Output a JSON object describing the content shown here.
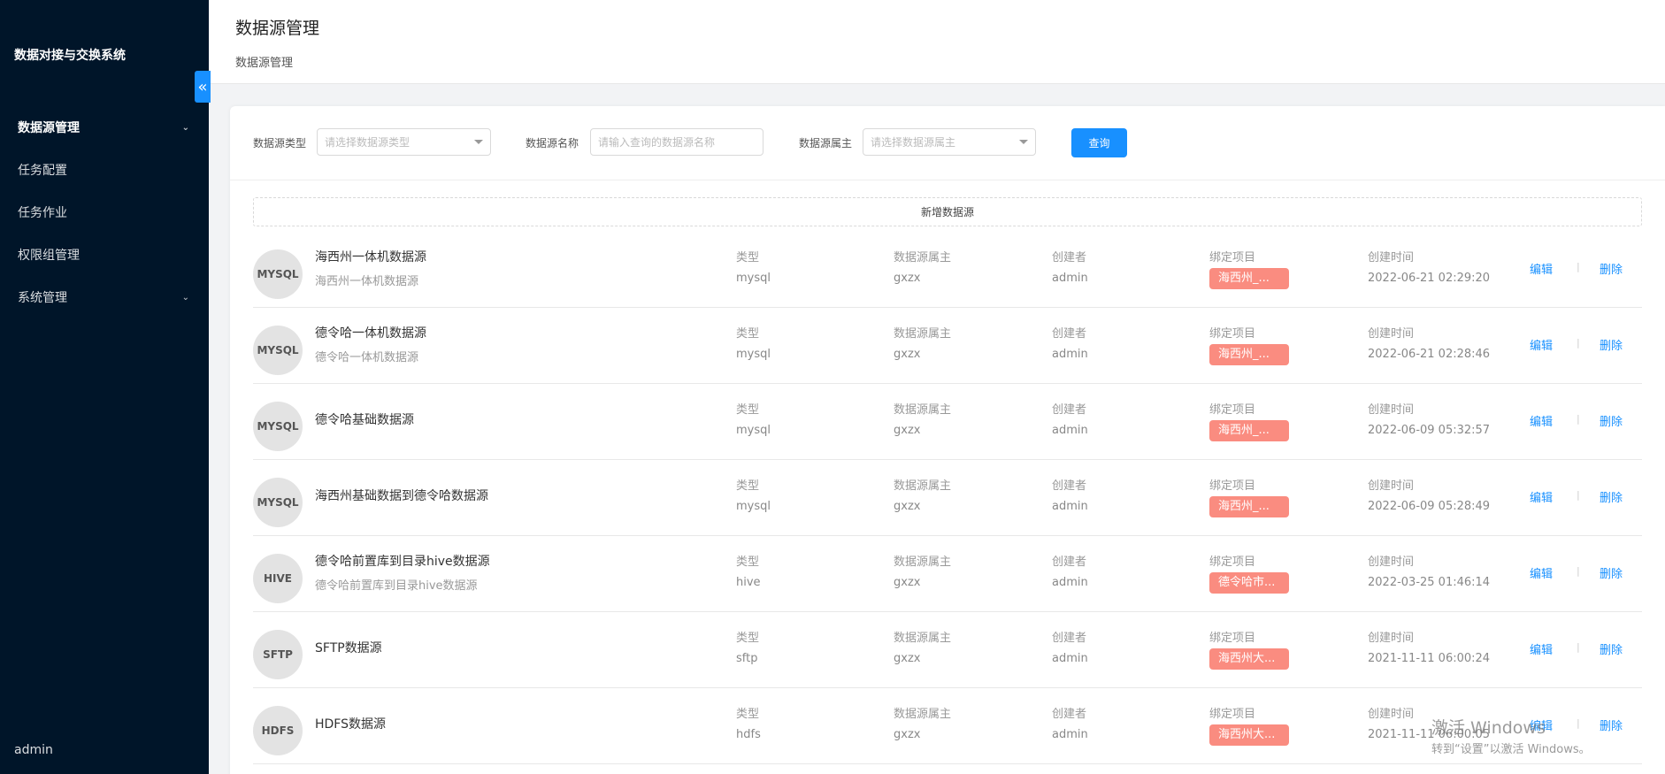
{
  "sidebar": {
    "app_title": "数据对接与交换系统",
    "collapse_icon": "«",
    "items": [
      {
        "label": "数据源管理",
        "has_children": true
      },
      {
        "label": "任务配置",
        "has_children": false
      },
      {
        "label": "任务作业",
        "has_children": false
      },
      {
        "label": "权限组管理",
        "has_children": false
      },
      {
        "label": "系统管理",
        "has_children": true
      }
    ],
    "chevron": "⌄",
    "user": "admin"
  },
  "header": {
    "title": "数据源管理",
    "breadcrumb": "数据源管理"
  },
  "filters": {
    "type_label": "数据源类型",
    "type_placeholder": "请选择数据源类型",
    "name_label": "数据源名称",
    "name_placeholder": "请输入查询的数据源名称",
    "owner_label": "数据源属主",
    "owner_placeholder": "请选择数据源属主",
    "query_label": "查询"
  },
  "add_label": "新增数据源",
  "list_labels": {
    "type": "类型",
    "owner": "数据源属主",
    "creator": "创建者",
    "project": "绑定项目",
    "created": "创建时间",
    "edit": "编辑",
    "delete": "删除",
    "separator": "|"
  },
  "rows": [
    {
      "badge": "MYSQL",
      "name": "海西州一体机数据源",
      "desc": "海西州一体机数据源",
      "type": "mysql",
      "owner": "gxzx",
      "creator": "admin",
      "project": "海西州_...",
      "created": "2022-06-21 02:29:20"
    },
    {
      "badge": "MYSQL",
      "name": "德令哈一体机数据源",
      "desc": "德令哈一体机数据源",
      "type": "mysql",
      "owner": "gxzx",
      "creator": "admin",
      "project": "海西州_...",
      "created": "2022-06-21 02:28:46"
    },
    {
      "badge": "MYSQL",
      "name": "德令哈基础数据源",
      "desc": "",
      "type": "mysql",
      "owner": "gxzx",
      "creator": "admin",
      "project": "海西州_...",
      "created": "2022-06-09 05:32:57"
    },
    {
      "badge": "MYSQL",
      "name": "海西州基础数据到德令哈数据源",
      "desc": "",
      "type": "mysql",
      "owner": "gxzx",
      "creator": "admin",
      "project": "海西州_...",
      "created": "2022-06-09 05:28:49"
    },
    {
      "badge": "HIVE",
      "name": "德令哈前置库到目录hive数据源",
      "desc": "德令哈前置库到目录hive数据源",
      "type": "hive",
      "owner": "gxzx",
      "creator": "admin",
      "project": "德令哈市...",
      "created": "2022-03-25 01:46:14"
    },
    {
      "badge": "SFTP",
      "name": "SFTP数据源",
      "desc": "",
      "type": "sftp",
      "owner": "gxzx",
      "creator": "admin",
      "project": "海西州大...",
      "created": "2021-11-11 06:00:24"
    },
    {
      "badge": "HDFS",
      "name": "HDFS数据源",
      "desc": "",
      "type": "hdfs",
      "owner": "gxzx",
      "creator": "admin",
      "project": "海西州大...",
      "created": "2021-11-11 06:00:05"
    }
  ],
  "watermark": {
    "line1": "激活 Windows",
    "line2": "转到“设置”以激活 Windows。"
  }
}
